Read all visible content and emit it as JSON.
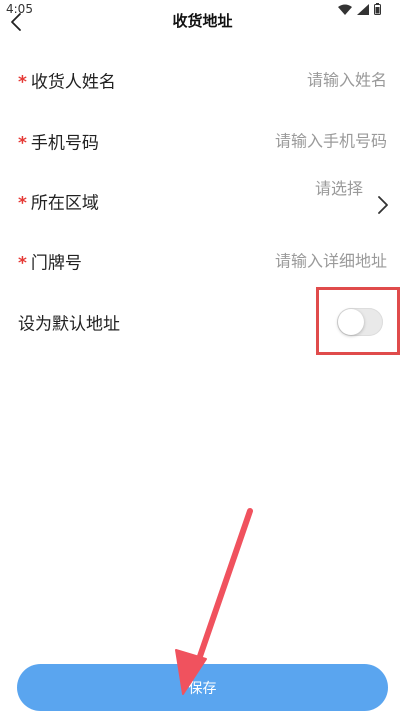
{
  "status_bar": {
    "time": "4:05"
  },
  "header": {
    "title": "收货地址"
  },
  "form": {
    "name": {
      "required_mark": "*",
      "label": "收货人姓名",
      "placeholder": "请输入姓名"
    },
    "phone": {
      "required_mark": "*",
      "label": "手机号码",
      "placeholder": "请输入手机号码"
    },
    "region": {
      "required_mark": "*",
      "label": "所在区域",
      "placeholder": "请选择"
    },
    "house_number": {
      "required_mark": "*",
      "label": "门牌号",
      "placeholder": "请输入详细地址"
    },
    "default_address": {
      "label": "设为默认地址",
      "enabled": false
    }
  },
  "save_button": {
    "label": "保存"
  },
  "colors": {
    "required": "#e53935",
    "primary_button": "#5aa5ef",
    "highlight_box": "#e04b4b",
    "annotation_arrow": "#f0525e",
    "placeholder": "#9a9a9a"
  },
  "icons": {
    "back": "chevron-left-icon",
    "region_picker": "chevron-right-icon",
    "wifi": "wifi-icon",
    "signal": "signal-icon",
    "battery": "battery-icon"
  }
}
